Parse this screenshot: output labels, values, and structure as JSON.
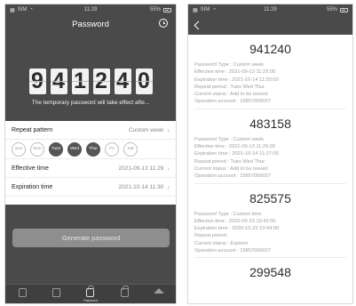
{
  "left": {
    "status": {
      "carrier": "SIM",
      "time": "11:29",
      "battery": "55%"
    },
    "title": "Password",
    "digits": [
      "9",
      "4",
      "1",
      "2",
      "4",
      "0"
    ],
    "notice": "The temporary password will take effect afte...",
    "repeat_pattern": {
      "label": "Repeat pattern",
      "value": "Custom week"
    },
    "days": [
      {
        "label": "Sun",
        "selected": false
      },
      {
        "label": "Mon",
        "selected": false
      },
      {
        "label": "Tues",
        "selected": true
      },
      {
        "label": "Wed",
        "selected": true
      },
      {
        "label": "Thur",
        "selected": true
      },
      {
        "label": "Fri",
        "selected": false
      },
      {
        "label": "Sat",
        "selected": false
      }
    ],
    "effective": {
      "label": "Effective time",
      "value": "2021-09-13 11:29"
    },
    "expiration": {
      "label": "Expiration time",
      "value": "2021-10-14 11:30"
    },
    "generate_label": "Generate password",
    "tabs": [
      {
        "label": "",
        "icon": "device-icon"
      },
      {
        "label": "",
        "icon": "list-icon"
      },
      {
        "label": "Password",
        "icon": "lock-icon"
      },
      {
        "label": "",
        "icon": "lock-outline-icon"
      },
      {
        "label": "",
        "icon": "home-icon"
      }
    ]
  },
  "right": {
    "status": {
      "carrier": "SIM",
      "time": "11:29",
      "battery": "55%"
    },
    "records": [
      {
        "code": "941240",
        "lines": [
          "Password Type : Custom week",
          "Effective time : 2021-09-13 11:29:00",
          "Expiration time : 2021-10-14 11:30:00",
          "Repeat period : Tues Wed Thur",
          "Current status : Add to be issued",
          "Operation account : 15857069037"
        ]
      },
      {
        "code": "483158",
        "lines": [
          "Password Type : Custom week",
          "Effective time : 2021-09-13 11:26:00",
          "Expiration time : 2021-10-14 11:27:00",
          "Repeat period : Tues Wed Thur",
          "Current status : Add to be issued",
          "Operation account : 15857069037"
        ]
      },
      {
        "code": "825575",
        "lines": [
          "Password Type : Custom time",
          "Effective time : 2020-09-23 10:42:00",
          "Expiration time : 2020-10-23 10:44:00",
          "Repeat period :",
          "Current status : Expired",
          "Operation account : 15857069037"
        ]
      },
      {
        "code": "299548",
        "lines": []
      }
    ]
  }
}
